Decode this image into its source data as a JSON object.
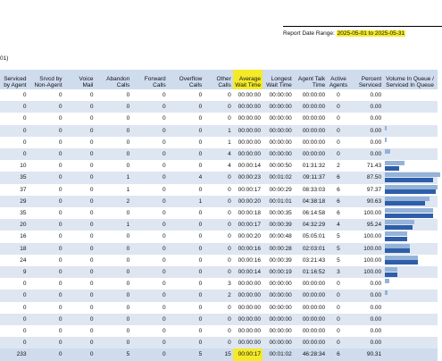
{
  "report": {
    "date_range_label": "Report Date Range:",
    "date_range_value": "2025-05-01 to 2025-05-31",
    "fragment": "01)"
  },
  "columns": [
    "Serviced\nby Agent",
    "Srvcd by\nNon-Agent",
    "Voice\nMail",
    "Abandon\nCalls",
    "Forward\nCalls",
    "Overflow\nCalls",
    "Other\nCalls",
    "Average\nWait Time",
    "Longest\nWait Time",
    "Agent Talk\nTime",
    "Active\nAgents",
    "Percent\nServiced",
    "Volume In Queue /\nServiced In Queue"
  ],
  "rows": [
    {
      "cells": [
        "0",
        "0",
        "0",
        "0",
        "0",
        "0",
        "0",
        "00:00:00",
        "00:00:00",
        "00:00:00",
        "0",
        "0.00"
      ],
      "vq": 0,
      "sq": 0
    },
    {
      "cells": [
        "0",
        "0",
        "0",
        "0",
        "0",
        "0",
        "0",
        "00:00:00",
        "00:00:00",
        "00:00:00",
        "0",
        "0.00"
      ],
      "vq": 0,
      "sq": 0
    },
    {
      "cells": [
        "0",
        "0",
        "0",
        "0",
        "0",
        "0",
        "0",
        "00:00:00",
        "00:00:00",
        "00:00:00",
        "0",
        "0.00"
      ],
      "vq": 0,
      "sq": 0
    },
    {
      "cells": [
        "0",
        "0",
        "0",
        "0",
        "0",
        "0",
        "1",
        "00:00:00",
        "00:00:00",
        "00:00:00",
        "0",
        "0.00"
      ],
      "vq": 1,
      "sq": 0
    },
    {
      "cells": [
        "0",
        "0",
        "0",
        "0",
        "0",
        "0",
        "1",
        "00:00:00",
        "00:00:00",
        "00:00:00",
        "0",
        "0.00"
      ],
      "vq": 1,
      "sq": 0
    },
    {
      "cells": [
        "0",
        "0",
        "0",
        "0",
        "0",
        "0",
        "4",
        "00:00:00",
        "00:00:00",
        "00:00:00",
        "0",
        "0.00"
      ],
      "vq": 4,
      "sq": 0
    },
    {
      "cells": [
        "10",
        "0",
        "0",
        "0",
        "0",
        "0",
        "4",
        "00:00:14",
        "00:00:50",
        "01:31:32",
        "2",
        "71.43"
      ],
      "vq": 14,
      "sq": 10
    },
    {
      "cells": [
        "35",
        "0",
        "0",
        "1",
        "0",
        "4",
        "0",
        "00:00:23",
        "00:01:02",
        "09:11:37",
        "6",
        "87.50"
      ],
      "vq": 40,
      "sq": 35
    },
    {
      "cells": [
        "37",
        "0",
        "0",
        "1",
        "0",
        "0",
        "0",
        "00:00:17",
        "00:00:29",
        "08:33:03",
        "6",
        "97.37"
      ],
      "vq": 38,
      "sq": 37
    },
    {
      "cells": [
        "29",
        "0",
        "0",
        "2",
        "0",
        "1",
        "0",
        "00:00:20",
        "00:01:01",
        "04:38:18",
        "6",
        "90.63"
      ],
      "vq": 32,
      "sq": 29
    },
    {
      "cells": [
        "35",
        "0",
        "0",
        "0",
        "0",
        "0",
        "0",
        "00:00:18",
        "00:00:35",
        "06:14:58",
        "6",
        "100.00"
      ],
      "vq": 35,
      "sq": 35
    },
    {
      "cells": [
        "20",
        "0",
        "0",
        "1",
        "0",
        "0",
        "0",
        "00:00:17",
        "00:00:39",
        "04:32:29",
        "4",
        "95.24"
      ],
      "vq": 21,
      "sq": 20
    },
    {
      "cells": [
        "16",
        "0",
        "0",
        "0",
        "0",
        "0",
        "0",
        "00:00:20",
        "00:00:48",
        "05:05:01",
        "5",
        "100.00"
      ],
      "vq": 16,
      "sq": 16
    },
    {
      "cells": [
        "18",
        "0",
        "0",
        "0",
        "0",
        "0",
        "0",
        "00:00:16",
        "00:00:28",
        "02:03:01",
        "5",
        "100.00"
      ],
      "vq": 18,
      "sq": 18
    },
    {
      "cells": [
        "24",
        "0",
        "0",
        "0",
        "0",
        "0",
        "0",
        "00:00:16",
        "00:00:39",
        "03:21:43",
        "5",
        "100.00"
      ],
      "vq": 24,
      "sq": 24
    },
    {
      "cells": [
        "9",
        "0",
        "0",
        "0",
        "0",
        "0",
        "0",
        "00:00:14",
        "00:00:19",
        "01:16:52",
        "3",
        "100.00"
      ],
      "vq": 9,
      "sq": 9
    },
    {
      "cells": [
        "0",
        "0",
        "0",
        "0",
        "0",
        "0",
        "3",
        "00:00:00",
        "00:00:00",
        "00:00:00",
        "0",
        "0.00"
      ],
      "vq": 3,
      "sq": 0
    },
    {
      "cells": [
        "0",
        "0",
        "0",
        "0",
        "0",
        "0",
        "2",
        "00:00:00",
        "00:00:00",
        "00:00:00",
        "0",
        "0.00"
      ],
      "vq": 2,
      "sq": 0
    },
    {
      "cells": [
        "0",
        "0",
        "0",
        "0",
        "0",
        "0",
        "0",
        "00:00:00",
        "00:00:00",
        "00:00:00",
        "0",
        "0.00"
      ],
      "vq": 0,
      "sq": 0
    },
    {
      "cells": [
        "0",
        "0",
        "0",
        "0",
        "0",
        "0",
        "0",
        "00:00:00",
        "00:00:00",
        "00:00:00",
        "0",
        "0.00"
      ],
      "vq": 0,
      "sq": 0
    },
    {
      "cells": [
        "0",
        "0",
        "0",
        "0",
        "0",
        "0",
        "0",
        "00:00:00",
        "00:00:00",
        "00:00:00",
        "0",
        "0.00"
      ],
      "vq": 0,
      "sq": 0
    },
    {
      "cells": [
        "0",
        "0",
        "0",
        "0",
        "0",
        "0",
        "0",
        "00:00:00",
        "00:00:00",
        "00:00:00",
        "0",
        "0.00"
      ],
      "vq": 0,
      "sq": 0
    }
  ],
  "total": [
    "233",
    "0",
    "0",
    "5",
    "0",
    "5",
    "15",
    "00:00:17",
    "00:01:02",
    "46:28:34",
    "6",
    "90.31"
  ],
  "colors": {
    "header_bg": "#cfdcee",
    "stripe_bg": "#dee6f2",
    "highlight": "#f4ea2a",
    "volume_bar": "#95b3d9",
    "serviced_bar": "#2e5ea9"
  }
}
